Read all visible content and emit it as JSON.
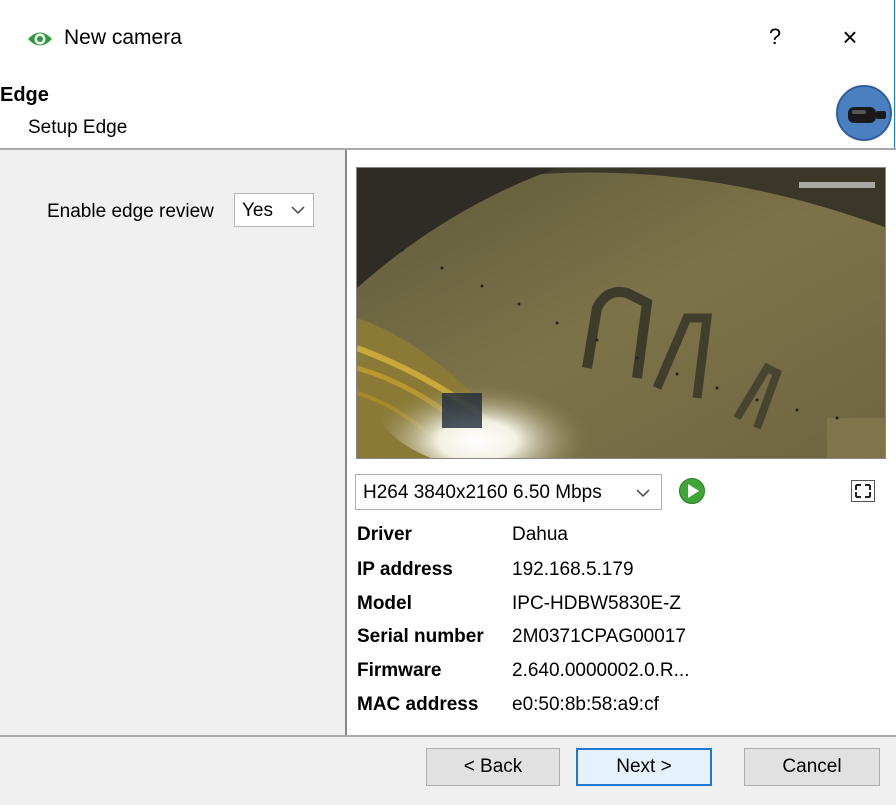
{
  "window": {
    "title": "New camera",
    "help_label": "?",
    "close_label": "×"
  },
  "header": {
    "title": "Edge",
    "subtitle": "Setup Edge"
  },
  "settings": {
    "enable_edge_review_label": "Enable edge review",
    "enable_edge_review_value": "Yes"
  },
  "stream": {
    "selected": "H264 3840x2160 6.50 Mbps"
  },
  "details": [
    {
      "label": "Driver",
      "value": "Dahua"
    },
    {
      "label": "IP address",
      "value": "192.168.5.179"
    },
    {
      "label": "Model",
      "value": "IPC-HDBW5830E-Z"
    },
    {
      "label": "Serial number",
      "value": "2M0371CPAG00017"
    },
    {
      "label": "Firmware",
      "value": "2.640.0000002.0.R..."
    },
    {
      "label": "MAC address",
      "value": "e0:50:8b:58:a9:cf"
    }
  ],
  "buttons": {
    "back": "< Back",
    "next": "Next >",
    "cancel": "Cancel"
  },
  "icons": {
    "title": "eye-icon",
    "badge": "camera-icon",
    "play": "play-icon",
    "fullscreen": "fullscreen-icon"
  },
  "colors": {
    "accent": "#1f78d1",
    "eye_green": "#2e9b3a",
    "play_green": "#3fa535",
    "badge_blue": "#4a7fc0"
  }
}
